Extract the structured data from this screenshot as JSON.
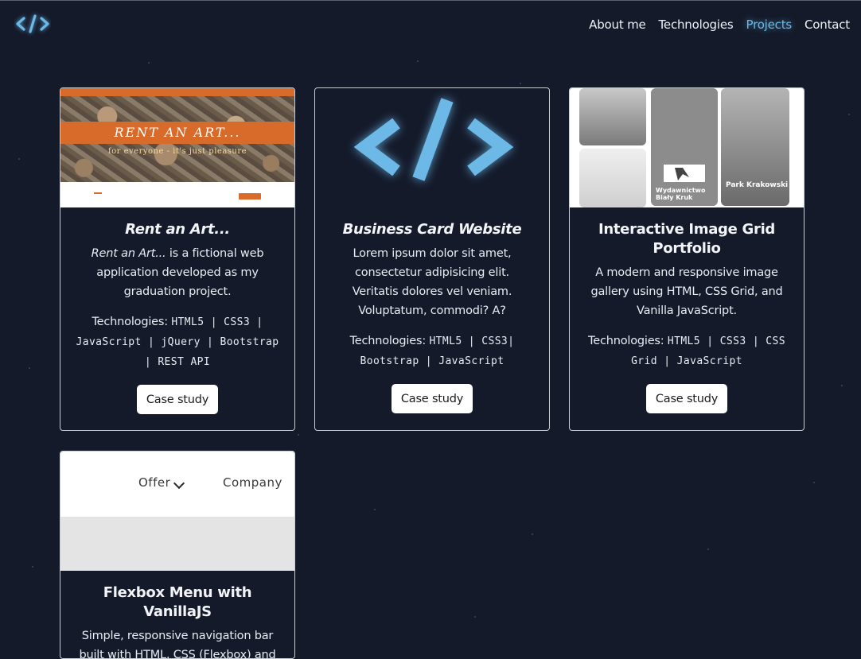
{
  "header": {
    "logo_icon": "code-brackets-icon",
    "nav": [
      {
        "label": "About me",
        "active": false
      },
      {
        "label": "Technologies",
        "active": false
      },
      {
        "label": "Projects",
        "active": true
      },
      {
        "label": "Contact",
        "active": false
      }
    ]
  },
  "colors": {
    "background": "#141a2a",
    "accent": "#6cb8e6",
    "card_border": "#c8ccd4"
  },
  "projects": [
    {
      "title": "Rent an Art...",
      "desc_em": "Rent an Art...",
      "desc_rest": " is a fictional web application developed as my graduation project.",
      "tech_prefix": "Technologies: ",
      "tech": "HTML5 | CSS3 | JavaScript | jQuery | Bootstrap | REST API",
      "button": "Case study",
      "thumb": {
        "banner": "RENT AN ART...",
        "subtitle": "for everyone - it's just pleasure"
      }
    },
    {
      "title": "Business Card Website",
      "description": "Lorem ipsum dolor sit amet, consectetur adipisicing elit. Veritatis dolores vel veniam. Voluptatum, commodi? A?",
      "tech_prefix": "Technologies: ",
      "tech": "HTML5 | CSS3| Bootstrap | JavaScript",
      "button": "Case study"
    },
    {
      "title": "Interactive Image Grid Portfolio",
      "description": "A modern and responsive image gallery using HTML, CSS Grid, and Vanilla JavaScript.",
      "tech_prefix": "Technologies: ",
      "tech": "HTML5 | CSS3 | CSS Grid | JavaScript",
      "button": "Case study",
      "thumb": {
        "caption_mid": "Wydawnictwo Biały Kruk",
        "caption_right": "Park Krakowski"
      }
    },
    {
      "title": "Flexbox Menu with VanillaJS",
      "description": "Simple, responsive navigation bar built with HTML, CSS (Flexbox) and",
      "thumb": {
        "menu_items": [
          "Offer",
          "Company"
        ]
      }
    }
  ]
}
